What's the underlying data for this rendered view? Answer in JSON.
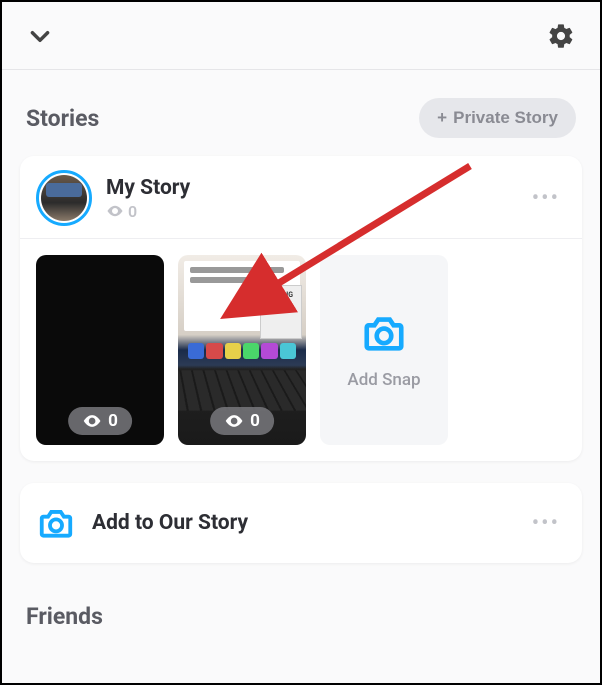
{
  "sections": {
    "stories_title": "Stories",
    "friends_title": "Friends"
  },
  "private_story_button": {
    "plus": "+",
    "label": "Private Story"
  },
  "my_story": {
    "title": "My Story",
    "views": "0",
    "snaps": [
      {
        "views": "0"
      },
      {
        "views": "0"
      }
    ],
    "add_snap_label": "Add Snap"
  },
  "our_story": {
    "label": "Add to Our Story"
  }
}
